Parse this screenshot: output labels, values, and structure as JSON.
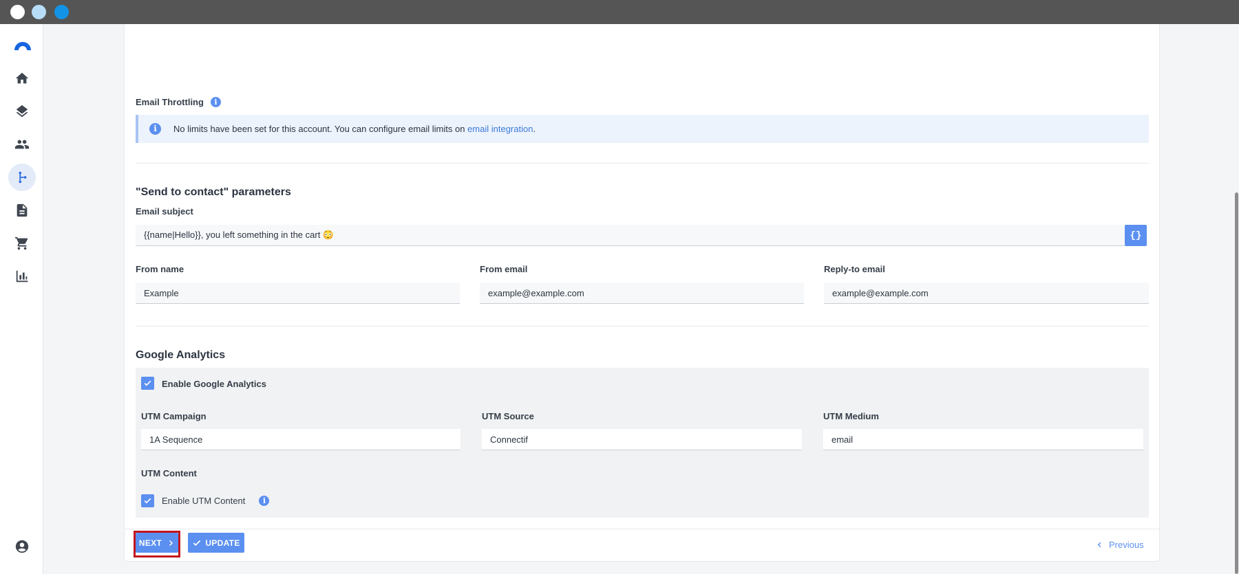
{
  "window": {
    "controls": [
      {
        "name": "close",
        "color": "#ffffff"
      },
      {
        "name": "minimize",
        "color": "#b8def7"
      },
      {
        "name": "maximize",
        "color": "#1393e6"
      }
    ]
  },
  "sidebar": {
    "logo_color": "#1565e0",
    "items": [
      {
        "id": "home",
        "icon": "home-icon"
      },
      {
        "id": "layers",
        "icon": "layers-icon"
      },
      {
        "id": "contacts",
        "icon": "people-icon"
      },
      {
        "id": "workflows",
        "icon": "flow-icon",
        "active": true
      },
      {
        "id": "documents",
        "icon": "document-icon"
      },
      {
        "id": "cart",
        "icon": "cart-icon"
      },
      {
        "id": "analytics",
        "icon": "bar-chart-icon"
      }
    ],
    "account_icon": "account-icon"
  },
  "throttling": {
    "label": "Email Throttling",
    "info_icon": "info-icon",
    "alert_text": "No limits have been set for this account. You can configure email limits on ",
    "alert_link": "email integration",
    "alert_end": "."
  },
  "send_to_contact": {
    "title": "\"Send to contact\" parameters",
    "subject_label": "Email subject",
    "subject_value": "{{name|Hello}}, you left something in the cart 😳",
    "braces_label": "{}",
    "from_name_label": "From name",
    "from_name_value": "Example",
    "from_email_label": "From email",
    "from_email_value": "example@example.com",
    "reply_to_label": "Reply-to email",
    "reply_to_value": "example@example.com"
  },
  "google_analytics": {
    "title": "Google Analytics",
    "enable_label": "Enable Google Analytics",
    "enable_checked": true,
    "utm_campaign_label": "UTM Campaign",
    "utm_campaign_value": "1A Sequence",
    "utm_source_label": "UTM Source",
    "utm_source_value": "Connectif",
    "utm_medium_label": "UTM Medium",
    "utm_medium_value": "email",
    "utm_content_label": "UTM Content",
    "enable_utm_content_label": "Enable UTM Content",
    "enable_utm_content_checked": true
  },
  "footer": {
    "next_label": "NEXT",
    "update_label": "UPDATE",
    "previous_label": "Previous"
  },
  "colors": {
    "accent": "#5b8ff0",
    "highlight": "#c1151c",
    "link": "#3b7ad9"
  }
}
